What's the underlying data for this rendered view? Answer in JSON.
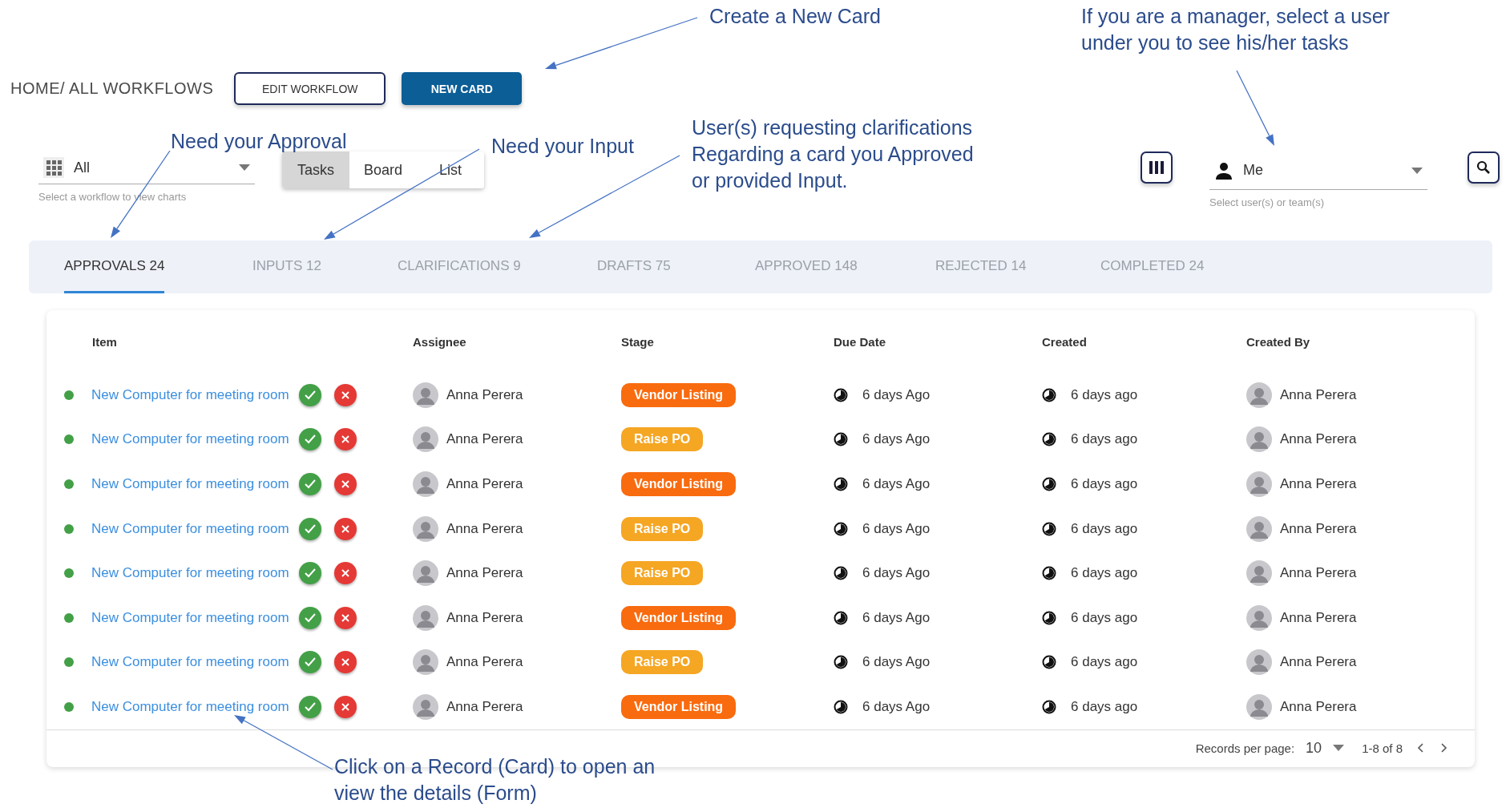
{
  "annotations": [
    {
      "lines": [
        "Create a New Card"
      ]
    },
    {
      "lines": [
        "If you are a manager, select a user",
        "under you to see his/her tasks"
      ]
    },
    {
      "lines": [
        "Need your Approval"
      ]
    },
    {
      "lines": [
        "Need your Input"
      ]
    },
    {
      "lines": [
        "User(s) requesting clarifications",
        "Regarding a card you Approved",
        "or provided Input."
      ]
    },
    {
      "lines": [
        "Click on a Record (Card) to open an",
        "view the details (Form)"
      ]
    }
  ],
  "breadcrumb": "HOME/ ALL WORKFLOWS",
  "buttons": {
    "edit": "EDIT WORKFLOW",
    "new": "NEW CARD"
  },
  "workflow_select": {
    "value": "All",
    "hint": "Select a workflow to view charts"
  },
  "views": [
    {
      "label": "Tasks",
      "selected": true
    },
    {
      "label": "Board",
      "selected": false
    },
    {
      "label": "List",
      "selected": false
    }
  ],
  "user_select": {
    "value": "Me",
    "hint": "Select user(s) or team(s)"
  },
  "tabs": [
    {
      "label": "APPROVALS",
      "count": "24",
      "selected": true
    },
    {
      "label": "INPUTS",
      "count": "12",
      "selected": false
    },
    {
      "label": "CLARIFICATIONS",
      "count": "9",
      "selected": false
    },
    {
      "label": "DRAFTS",
      "count": "75",
      "selected": false
    },
    {
      "label": "APPROVED",
      "count": "148",
      "selected": false
    },
    {
      "label": "REJECTED",
      "count": "14",
      "selected": false
    },
    {
      "label": "COMPLETED",
      "count": "24",
      "selected": false
    }
  ],
  "table": {
    "columns": [
      "Item",
      "Assignee",
      "Stage",
      "Due Date",
      "Created",
      "Created By"
    ],
    "rows": [
      {
        "item": "New Computer for meeting room",
        "assignee": "Anna Perera",
        "stage": {
          "label": "Vendor Listing",
          "color": "#f96b0f"
        },
        "due": "6 days Ago",
        "created": "6 days ago",
        "created_by": "Anna Perera"
      },
      {
        "item": "New Computer for meeting room",
        "assignee": "Anna Perera",
        "stage": {
          "label": "Raise PO",
          "color": "#f5a623"
        },
        "due": "6 days Ago",
        "created": "6 days ago",
        "created_by": "Anna Perera"
      },
      {
        "item": "New Computer for meeting room",
        "assignee": "Anna Perera",
        "stage": {
          "label": "Vendor Listing",
          "color": "#f96b0f"
        },
        "due": "6 days Ago",
        "created": "6 days ago",
        "created_by": "Anna Perera"
      },
      {
        "item": "New Computer for meeting room",
        "assignee": "Anna Perera",
        "stage": {
          "label": "Raise PO",
          "color": "#f5a623"
        },
        "due": "6 days Ago",
        "created": "6 days ago",
        "created_by": "Anna Perera"
      },
      {
        "item": "New Computer for meeting room",
        "assignee": "Anna Perera",
        "stage": {
          "label": "Raise PO",
          "color": "#f5a623"
        },
        "due": "6 days Ago",
        "created": "6 days ago",
        "created_by": "Anna Perera"
      },
      {
        "item": "New Computer for meeting room",
        "assignee": "Anna Perera",
        "stage": {
          "label": "Vendor Listing",
          "color": "#f96b0f"
        },
        "due": "6 days Ago",
        "created": "6 days ago",
        "created_by": "Anna Perera"
      },
      {
        "item": "New Computer for meeting room",
        "assignee": "Anna Perera",
        "stage": {
          "label": "Raise PO",
          "color": "#f5a623"
        },
        "due": "6 days Ago",
        "created": "6 days ago",
        "created_by": "Anna Perera"
      },
      {
        "item": "New Computer for meeting room",
        "assignee": "Anna Perera",
        "stage": {
          "label": "Vendor Listing",
          "color": "#f96b0f"
        },
        "due": "6 days Ago",
        "created": "6 days ago",
        "created_by": "Anna Perera"
      }
    ]
  },
  "pagination": {
    "label": "Records per page:",
    "per_page": "10",
    "range": "1-8 of 8"
  }
}
